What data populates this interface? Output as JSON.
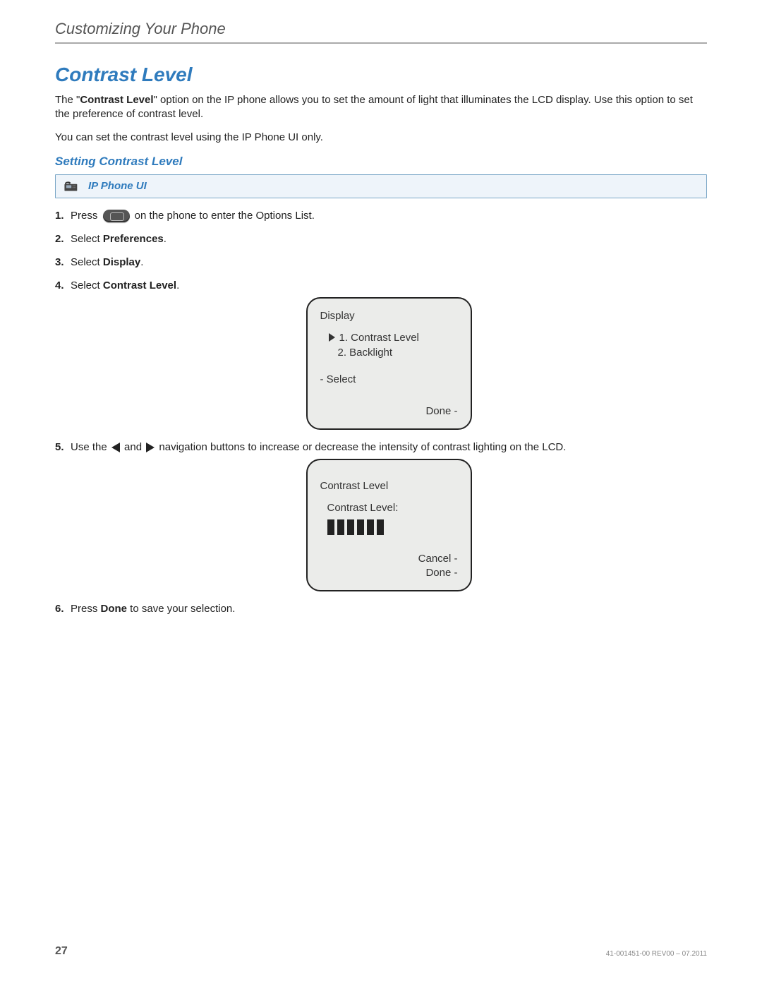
{
  "chapter": "Customizing Your Phone",
  "section_title": "Contrast Level",
  "intro_para_prefix": "The \"",
  "intro_para_bold": "Contrast Level",
  "intro_para_suffix": "\" option on the IP phone allows you to set the amount of light that illuminates the LCD display. Use this option to set the preference of contrast level.",
  "intro_para2": "You can set the contrast level using the IP Phone UI only.",
  "subsection_title": "Setting Contrast Level",
  "banner_label": "IP Phone UI",
  "steps": {
    "s1_a": "Press ",
    "s1_b": " on the phone to enter the Options List.",
    "s2_a": "Select ",
    "s2_b": "Preferences",
    "s2_c": ".",
    "s3_a": "Select ",
    "s3_b": "Display",
    "s3_c": ".",
    "s4_a": "Select ",
    "s4_b": "Contrast Level",
    "s4_c": ".",
    "s5_a": "Use the ",
    "s5_b": " and ",
    "s5_c": " navigation buttons to increase or decrease the intensity of contrast lighting on the LCD.",
    "s6_a": "Press ",
    "s6_b": "Done",
    "s6_c": " to save your selection."
  },
  "lcd1": {
    "title": "Display",
    "item1": "1. Contrast Level",
    "item2": "2. Backlight",
    "select": "- Select",
    "done": "Done -"
  },
  "lcd2": {
    "title": "Contrast Level",
    "sub": "Contrast Level:",
    "cancel": "Cancel -",
    "done": "Done -",
    "bars": 6
  },
  "footer": {
    "page": "27",
    "docid": "41-001451-00 REV00 – 07.2011"
  }
}
